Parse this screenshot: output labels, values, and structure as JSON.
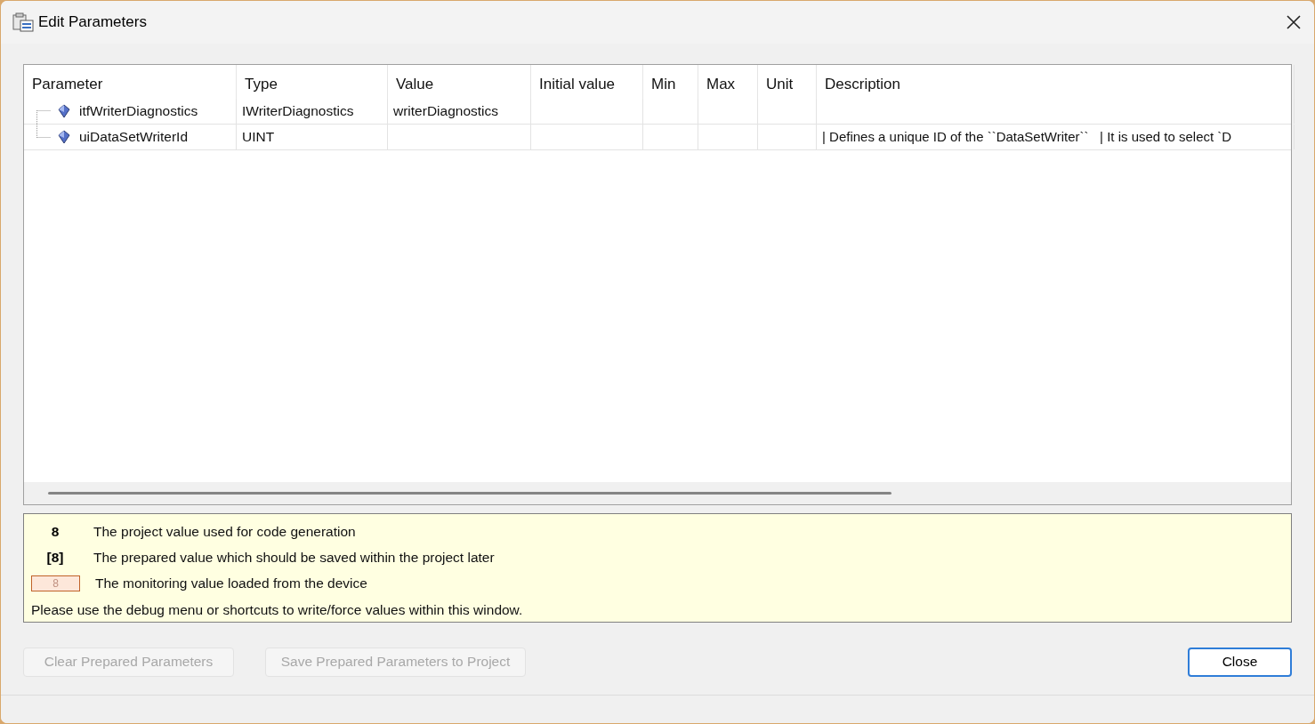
{
  "window": {
    "title": "Edit Parameters"
  },
  "table": {
    "columns": [
      "Parameter",
      "Type",
      "Value",
      "Initial value",
      "Min",
      "Max",
      "Unit",
      "Description"
    ],
    "rows": [
      {
        "cells": [
          "itfWriterDiagnostics",
          "IWriterDiagnostics",
          "writerDiagnostics",
          "",
          "",
          "",
          "",
          ""
        ]
      },
      {
        "cells": [
          "uiDataSetWriterId",
          "UINT",
          "",
          "",
          "",
          "",
          "",
          "| Defines a unique ID of the ``DataSetWriter``   | It is used to select `D"
        ]
      }
    ]
  },
  "legend": {
    "items": [
      {
        "kind": "project",
        "sample": "8",
        "text": "The project value used for code generation"
      },
      {
        "kind": "prepared",
        "sample": "[8]",
        "text": "The prepared value which should be saved within the project later"
      },
      {
        "kind": "monitoring",
        "sample": "8",
        "text": "The monitoring value loaded from the device"
      }
    ],
    "note": "Please use the debug menu or shortcuts to write/force values within this window."
  },
  "buttons": [
    {
      "label": "Clear Prepared Parameters",
      "disabled": true
    },
    {
      "label": "Save Prepared Parameters to Project",
      "disabled": true
    }
  ],
  "close_button": {
    "label": "Close",
    "disabled": false
  }
}
